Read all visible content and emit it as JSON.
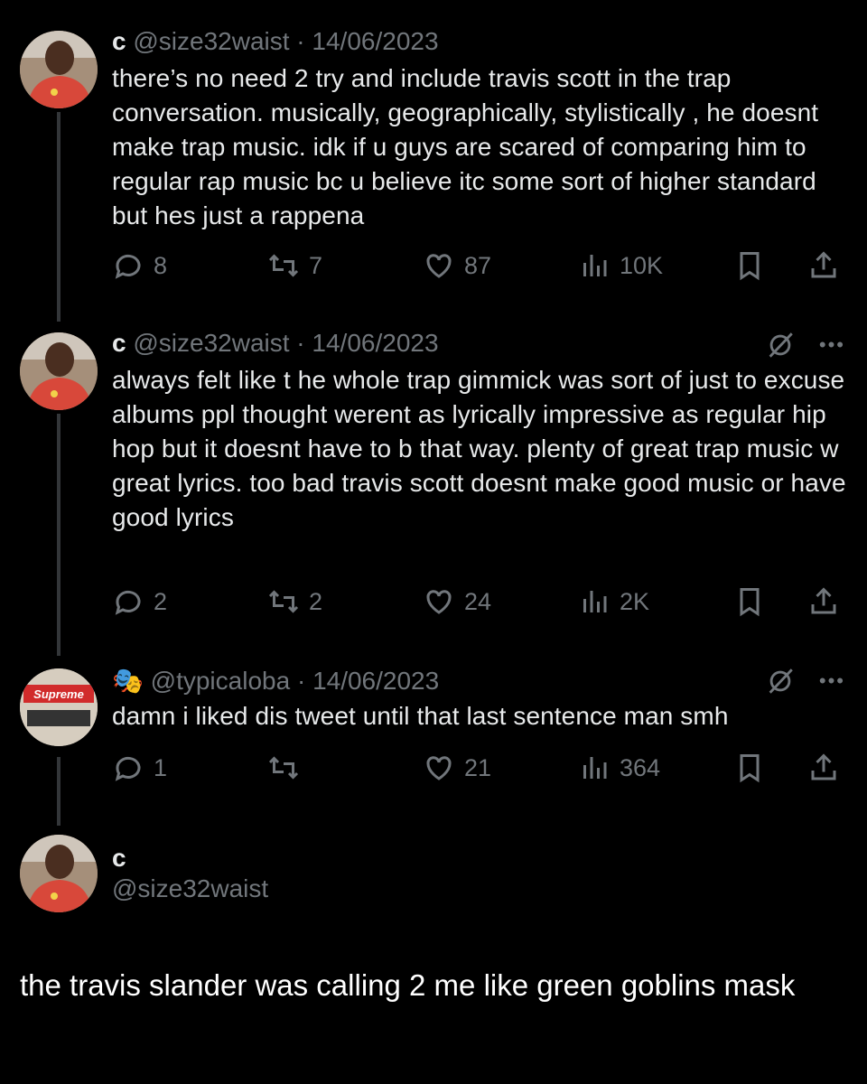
{
  "colors": {
    "background": "#000000",
    "text": "#e7e9ea",
    "muted": "#71767b",
    "thread": "#333639"
  },
  "tweets": [
    {
      "name": "c",
      "handle": "@size32waist",
      "separator": "·",
      "date": "14/06/2023",
      "text": "there’s no need 2 try and include travis scott in the trap conversation. musically, geographically, stylistically , he doesnt make trap music. idk if u guys are scared of comparing him to regular rap music bc u believe itc some sort of higher standard  but hes just a rappena",
      "replies": "8",
      "retweets": "7",
      "likes": "87",
      "views": "10K",
      "icons": [
        "reply-icon",
        "retweet-icon",
        "like-icon",
        "views-icon",
        "bookmark-icon",
        "share-icon"
      ]
    },
    {
      "name": "c",
      "handle": "@size32waist",
      "separator": "·",
      "date": "14/06/2023",
      "text": "always felt like t he whole trap gimmick was sort of just to excuse albums ppl thought  werent as lyrically impressive as regular hip hop but it doesnt have to b that way. plenty of great trap music w great lyrics.  too bad travis scott doesnt make good music or have good lyrics",
      "replies": "2",
      "retweets": "2",
      "likes": "24",
      "views": "2K",
      "icons": [
        "grok-icon",
        "more-icon"
      ]
    },
    {
      "name": "",
      "name_emoji": "🎭",
      "handle": "@typicaloba",
      "separator": "·",
      "date": "14/06/2023",
      "text": "damn i liked dis tweet until that last sentence man smh",
      "avatar_text": "Supreme",
      "replies": "1",
      "retweets": "",
      "likes": "21",
      "views": "364",
      "icons": [
        "grok-icon",
        "more-icon"
      ]
    }
  ],
  "profile": {
    "name": "c",
    "handle": "@size32waist"
  },
  "caption": "the travis slander  was calling 2  me like green goblins mask",
  "more_label": "•••"
}
